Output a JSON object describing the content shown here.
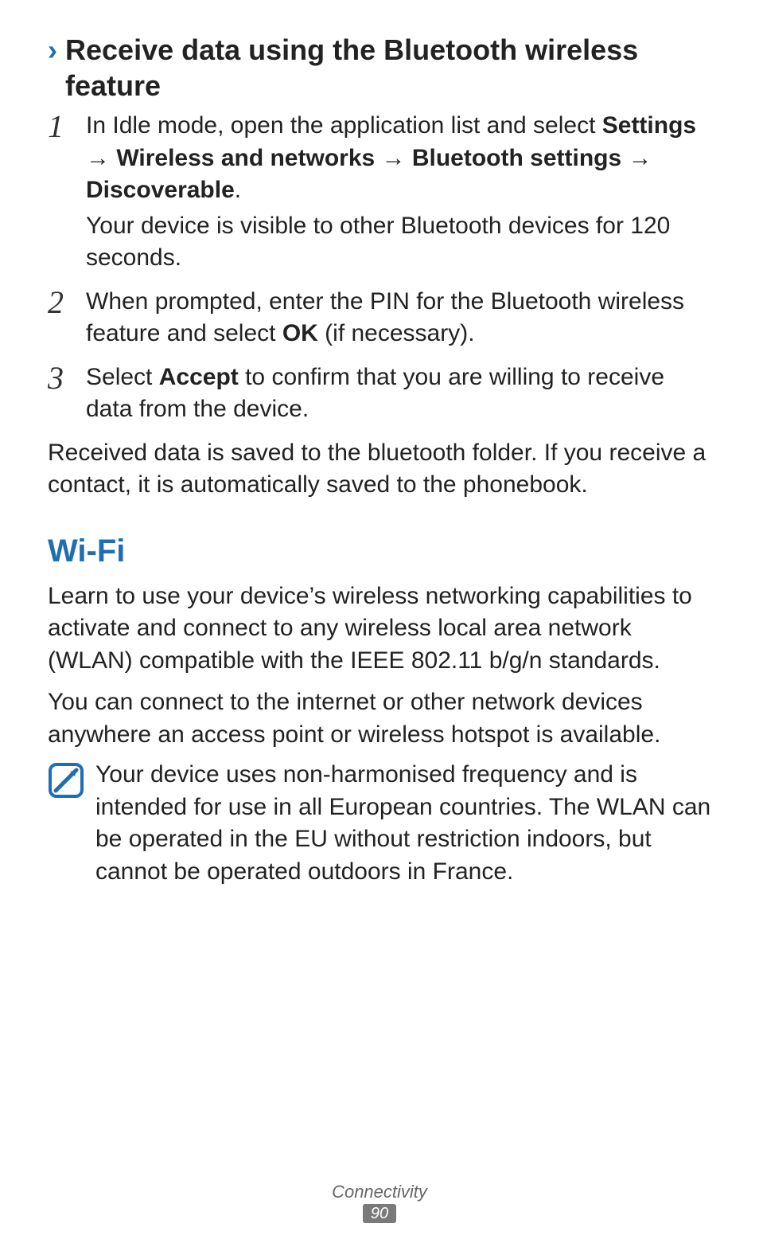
{
  "section": {
    "chevron": "›",
    "heading": "Receive data using the Bluetooth wireless feature"
  },
  "steps": [
    {
      "num": "1",
      "parts": [
        {
          "t": "In Idle mode, open the application list and select ",
          "b": false
        },
        {
          "t": "Settings",
          "b": true
        },
        {
          "t": " → ",
          "b": false,
          "arrow": true
        },
        {
          "t": "Wireless and networks",
          "b": true
        },
        {
          "t": " → ",
          "b": false,
          "arrow": true
        },
        {
          "t": "Bluetooth settings",
          "b": true
        },
        {
          "t": " → ",
          "b": false,
          "arrow": true
        },
        {
          "t": "Discoverable",
          "b": true
        },
        {
          "t": ".",
          "b": false
        }
      ],
      "sub": "Your device is visible to other Bluetooth devices for 120 seconds."
    },
    {
      "num": "2",
      "parts": [
        {
          "t": "When prompted, enter the PIN for the Bluetooth wireless feature and select ",
          "b": false
        },
        {
          "t": "OK",
          "b": true
        },
        {
          "t": " (if necessary).",
          "b": false
        }
      ]
    },
    {
      "num": "3",
      "parts": [
        {
          "t": "Select ",
          "b": false
        },
        {
          "t": "Accept",
          "b": true
        },
        {
          "t": " to confirm that you are willing to receive data from the device.",
          "b": false
        }
      ]
    }
  ],
  "after_steps": "Received data is saved to the bluetooth folder. If you receive a contact, it is automatically saved to the phonebook.",
  "wifi": {
    "heading": "Wi-Fi",
    "p1": "Learn to use your device’s wireless networking capabilities to activate and connect to any wireless local area network (WLAN) compatible with the IEEE 802.11 b/g/n standards.",
    "p2": "You can connect to the internet or other network devices anywhere an access point or wireless hotspot is available.",
    "note": "Your device uses non-harmonised frequency and is intended for use in all European countries. The WLAN can be operated in the EU without restriction indoors, but cannot be operated outdoors in France."
  },
  "footer": {
    "label": "Connectivity",
    "page": "90"
  }
}
